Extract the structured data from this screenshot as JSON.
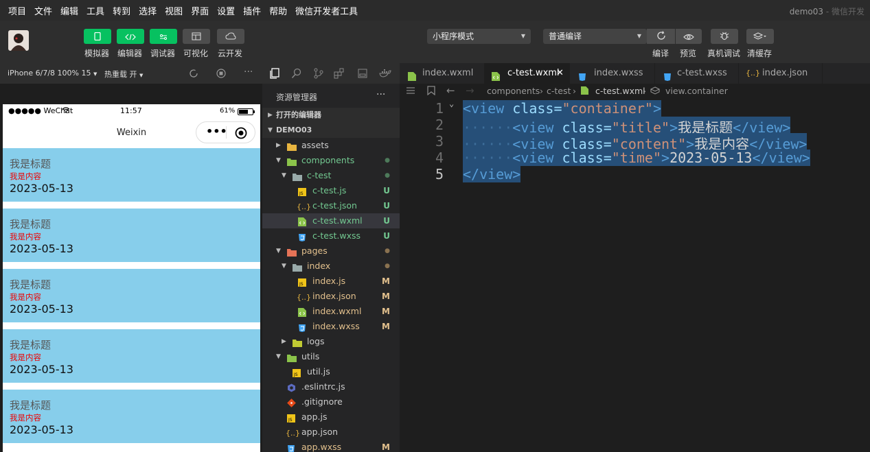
{
  "menubar": {
    "items": [
      "项目",
      "文件",
      "编辑",
      "工具",
      "转到",
      "选择",
      "视图",
      "界面",
      "设置",
      "插件",
      "帮助",
      "微信开发者工具"
    ],
    "project_name": "demo03",
    "app_name": "微信开发"
  },
  "toolbar": {
    "left_buttons": [
      {
        "label": "模拟器",
        "icon": "phone-icon"
      },
      {
        "label": "编辑器",
        "icon": "code-icon"
      },
      {
        "label": "调试器",
        "icon": "toggle-icon"
      },
      {
        "label": "可视化",
        "icon": "layout-icon"
      },
      {
        "label": "云开发",
        "icon": "cloud-icon"
      }
    ],
    "mode": "小程序模式",
    "compile_mode": "普通编译",
    "right_buttons": [
      {
        "label": "编译",
        "icon": "refresh-icon"
      },
      {
        "label": "预览",
        "icon": "eye-icon"
      },
      {
        "label": "真机调试",
        "icon": "bug-icon"
      },
      {
        "label": "清缓存",
        "icon": "layers-icon"
      }
    ]
  },
  "simulator": {
    "device": "iPhone 6/7/8 100% 15",
    "hot_reload": "热重载 开",
    "status_left": "●●●●● WeChat",
    "status_time": "11:57",
    "status_battery": "61%",
    "nav_title": "Weixin",
    "cards": [
      {
        "title": "我是标题",
        "content": "我是内容",
        "time": "2023-05-13"
      },
      {
        "title": "我是标题",
        "content": "我是内容",
        "time": "2023-05-13"
      },
      {
        "title": "我是标题",
        "content": "我是内容",
        "time": "2023-05-13"
      },
      {
        "title": "我是标题",
        "content": "我是内容",
        "time": "2023-05-13"
      },
      {
        "title": "我是标题",
        "content": "我是内容",
        "time": "2023-05-13"
      }
    ]
  },
  "explorer": {
    "title": "资源管理器",
    "more": "···",
    "open_editors": "打开的编辑器",
    "root": "DEMO03",
    "tree": [
      {
        "label": "assets",
        "status": ""
      },
      {
        "label": "components",
        "status": "●"
      },
      {
        "label": "c-test",
        "status": "●"
      },
      {
        "label": "c-test.js",
        "status": "U"
      },
      {
        "label": "c-test.json",
        "status": "U"
      },
      {
        "label": "c-test.wxml",
        "status": "U"
      },
      {
        "label": "c-test.wxss",
        "status": "U"
      },
      {
        "label": "pages",
        "status": "●"
      },
      {
        "label": "index",
        "status": "●"
      },
      {
        "label": "index.js",
        "status": "M"
      },
      {
        "label": "index.json",
        "status": "M"
      },
      {
        "label": "index.wxml",
        "status": "M"
      },
      {
        "label": "index.wxss",
        "status": "M"
      },
      {
        "label": "logs",
        "status": ""
      },
      {
        "label": "utils",
        "status": ""
      },
      {
        "label": "util.js",
        "status": ""
      },
      {
        "label": ".eslintrc.js",
        "status": ""
      },
      {
        "label": ".gitignore",
        "status": ""
      },
      {
        "label": "app.js",
        "status": ""
      },
      {
        "label": "app.json",
        "status": ""
      },
      {
        "label": "app.wxss",
        "status": "M"
      }
    ]
  },
  "editor": {
    "tabs": [
      {
        "label": "index.wxml",
        "active": false
      },
      {
        "label": "c-test.wxml",
        "active": true
      },
      {
        "label": "index.wxss",
        "active": false
      },
      {
        "label": "c-test.wxss",
        "active": false
      },
      {
        "label": "index.json",
        "active": false
      }
    ],
    "close_glyph": "✕",
    "breadcrumb": [
      "components",
      "c-test",
      "c-test.wxml",
      "view.container"
    ],
    "line_numbers": [
      "1",
      "2",
      "3",
      "4",
      "5"
    ],
    "code": {
      "l1": {
        "open": "<view",
        "attr": " class=",
        "val": "\"container\"",
        "close": ">"
      },
      "l2": {
        "open": "<view",
        "attr": " class=",
        "val": "\"title\"",
        "close": ">",
        "text": "我是标题",
        "end": "</view>"
      },
      "l3": {
        "open": "<view",
        "attr": " class=",
        "val": "\"content\"",
        "close": ">",
        "text": "我是内容",
        "end": "</view>"
      },
      "l4": {
        "open": "<view",
        "attr": " class=",
        "val": "\"time\"",
        "close": ">",
        "text": "2023-05-13",
        "end": "</view>"
      },
      "l5": {
        "end": "</view>"
      },
      "indent_dots": "······"
    }
  }
}
